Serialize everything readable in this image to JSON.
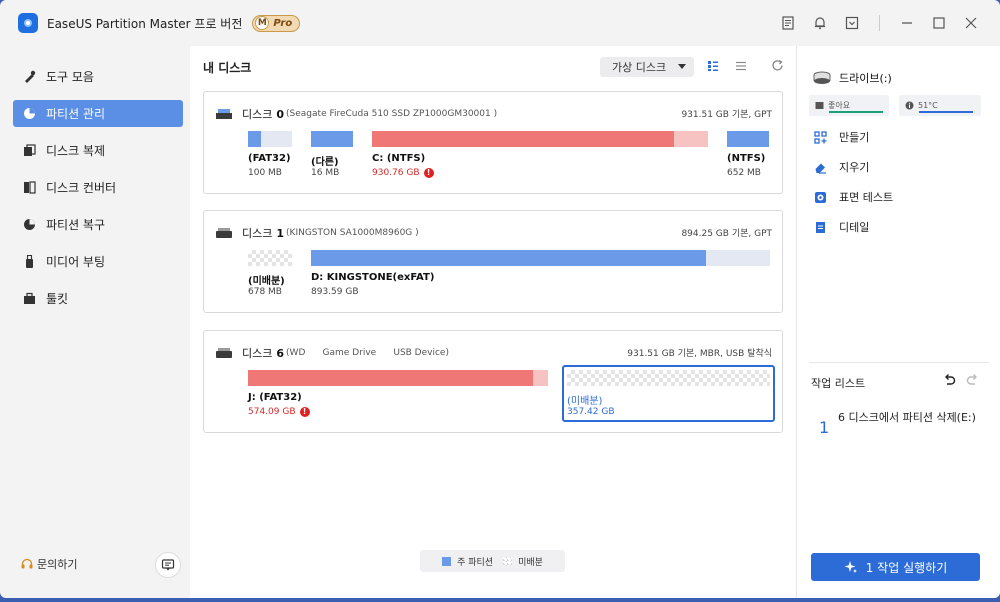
{
  "app": {
    "title": "EaseUS Partition Master 프로 버전",
    "badge_m": "M",
    "badge_pro": "Pro"
  },
  "titlebar_icons": [
    "feedback-icon",
    "bell-icon",
    "download-icon",
    "minimize-icon",
    "maximize-icon",
    "close-icon"
  ],
  "sidebar": {
    "items": [
      {
        "label": "도구 모음",
        "icon": "toolbox-icon"
      },
      {
        "label": "파티션 관리",
        "icon": "pie-icon"
      },
      {
        "label": "디스크 복제",
        "icon": "clone-icon"
      },
      {
        "label": "디스크 컨버터",
        "icon": "convert-icon"
      },
      {
        "label": "파티션 복구",
        "icon": "recover-icon"
      },
      {
        "label": "미디어 부팅",
        "icon": "usb-icon"
      },
      {
        "label": "툴킷",
        "icon": "toolkit-icon"
      }
    ],
    "active_index": 1,
    "help_label": "문의하기"
  },
  "main": {
    "title": "내 디스크",
    "virtual_disk_label": "가상 디스크",
    "disks": [
      {
        "name": "디스크",
        "num": "0",
        "model": "(Seagate FireCuda 510 SSD ZP1000GM30001 )",
        "info": "931.51 GB 기본, GPT",
        "partitions": [
          {
            "label": "(FAT32)",
            "size": "100 MB",
            "used": 0.3
          },
          {
            "label": "(다른)",
            "size": "16 MB",
            "used": 1.0
          },
          {
            "label": "C: (NTFS)",
            "size": "930.76 GB",
            "used": 0.9,
            "warning": true
          },
          {
            "label": "(NTFS)",
            "size": "652 MB",
            "used": 1.0
          }
        ]
      },
      {
        "name": "디스크",
        "num": "1",
        "model": "(KINGSTON SA1000M8960G )",
        "info": "894.25 GB 기본, GPT",
        "partitions": [
          {
            "label": "(미배분)",
            "size": "678 MB",
            "unallocated": true
          },
          {
            "label": "D: KINGSTONE(exFAT)",
            "size": "893.59 GB",
            "used": 0.86
          }
        ]
      },
      {
        "name": "디스크",
        "num": "6",
        "model": "(WD      Game Drive      USB Device)",
        "info": "931.51 GB 기본, MBR, USB 탈착식",
        "partitions": [
          {
            "label": "J: (FAT32)",
            "size": "574.09 GB",
            "used": 0.95,
            "warning": true
          },
          {
            "label": "(미배분)",
            "size": "357.42 GB",
            "unallocated": true,
            "selected": true
          }
        ]
      }
    ],
    "legend": {
      "primary": "주 파티션",
      "unallocated": "미배분"
    }
  },
  "right": {
    "drive_label": "드라이브(:)",
    "health_label": "좋아요",
    "temp_label": "51°C",
    "actions": [
      "만들기",
      "지우기",
      "표면 테스트",
      "디테일"
    ],
    "ops_title": "작업 리스트",
    "op_count": "1",
    "op_text": "6 디스크에서 파티션 삭제(E:)",
    "execute_label": "1 작업 실행하기"
  },
  "colors": {
    "accent": "#2d6bd6",
    "nav_active": "#5b8fe6",
    "primary_bar": "#6b9ae8",
    "warn_bar": "#ef7877",
    "warn_text": "#d62828"
  }
}
